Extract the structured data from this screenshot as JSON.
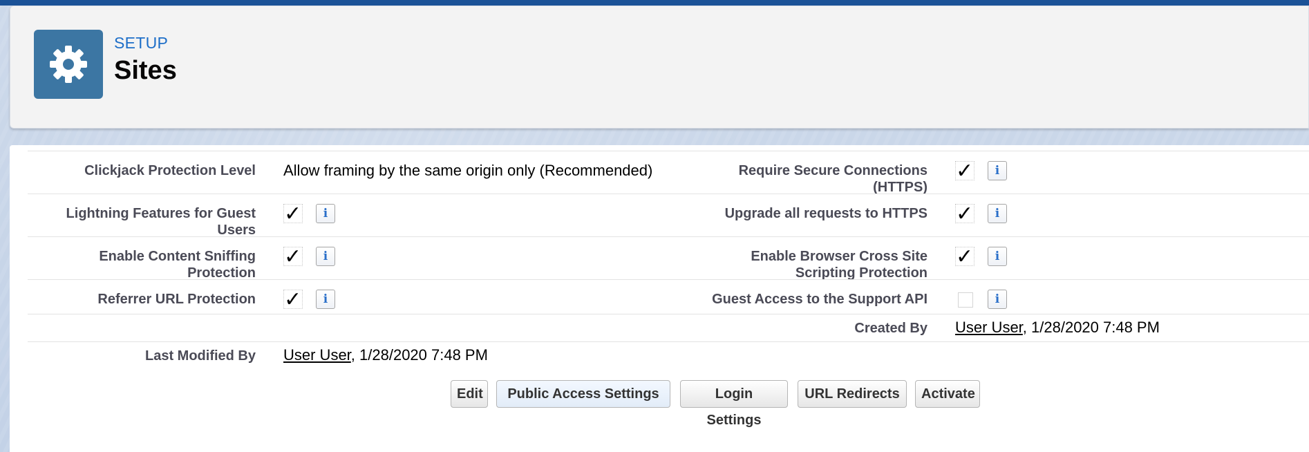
{
  "header": {
    "eyebrow": "SETUP",
    "title": "Sites",
    "icon": "gear-icon"
  },
  "settings": [
    {
      "left_label_lines": [
        "Clickjack Protection Level"
      ],
      "left_value": "Allow framing by the same origin only (Recommended)",
      "right_label_lines": [
        "Require Secure Connections",
        "(HTTPS)"
      ],
      "right_checked": true
    },
    {
      "left_label_lines": [
        "Lightning Features for Guest",
        "Users"
      ],
      "left_checked": true,
      "right_label_lines": [
        "Upgrade all requests to HTTPS"
      ],
      "right_checked": true
    },
    {
      "left_label_lines": [
        "Enable Content Sniffing",
        "Protection"
      ],
      "left_checked": true,
      "right_label_lines": [
        "Enable Browser Cross Site",
        "Scripting Protection"
      ],
      "right_checked": true
    },
    {
      "left_label_lines": [
        "Referrer URL Protection"
      ],
      "left_checked": true,
      "right_label_lines": [
        "Guest Access to the Support API"
      ],
      "right_checked": false
    }
  ],
  "created_by": {
    "label": "Created By",
    "user": "User User",
    "timestamp": ", 1/28/2020 7:48 PM"
  },
  "last_modified_by": {
    "label": "Last Modified By",
    "user": "User User",
    "timestamp": ", 1/28/2020 7:48 PM"
  },
  "buttons": {
    "edit": "Edit",
    "public_access": "Public Access Settings",
    "login": "Login Settings",
    "url_redirects": "URL Redirects",
    "activate": "Activate"
  },
  "info_glyph": "i",
  "check_glyph": "✓",
  "colors": {
    "header_icon_bg": "#3c76a3",
    "eyebrow": "#1d6ec8",
    "top_strip": "#1b5297"
  }
}
